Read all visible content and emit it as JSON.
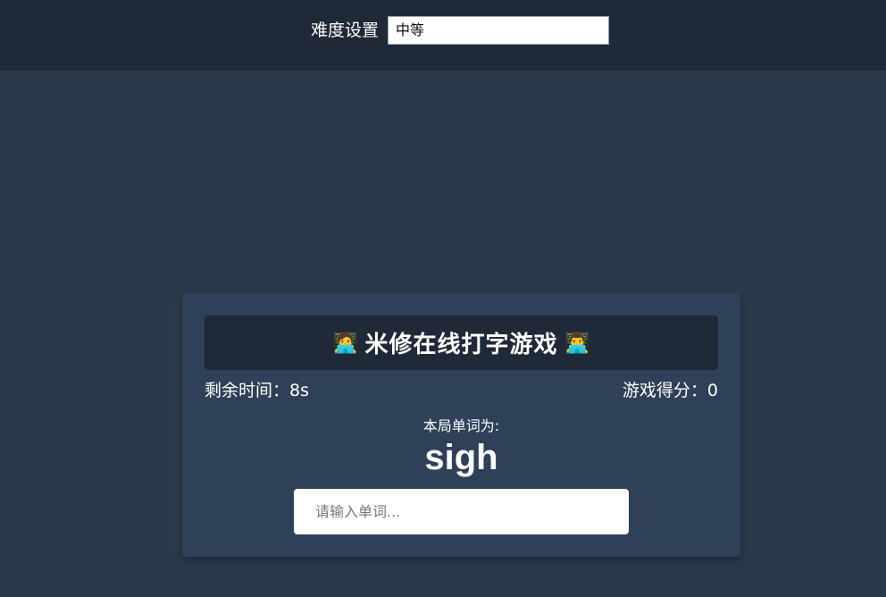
{
  "settings": {
    "difficulty_label": "难度设置",
    "difficulty_value": "中等"
  },
  "game": {
    "title": "米修在线打字游戏",
    "emoji_left": "🧑‍💻",
    "emoji_right": "👨‍💻",
    "time_label": "剩余时间：",
    "time_value": "8s",
    "score_label": "游戏得分：",
    "score_value": "0",
    "word_label": "本局单词为:",
    "word": "sigh",
    "input_placeholder": "请输入单词..."
  },
  "colors": {
    "page_background": "#2a3a4b",
    "topbar_background": "#1f2937",
    "card_background": "#2e4158",
    "banner_background": "#1f2937"
  }
}
